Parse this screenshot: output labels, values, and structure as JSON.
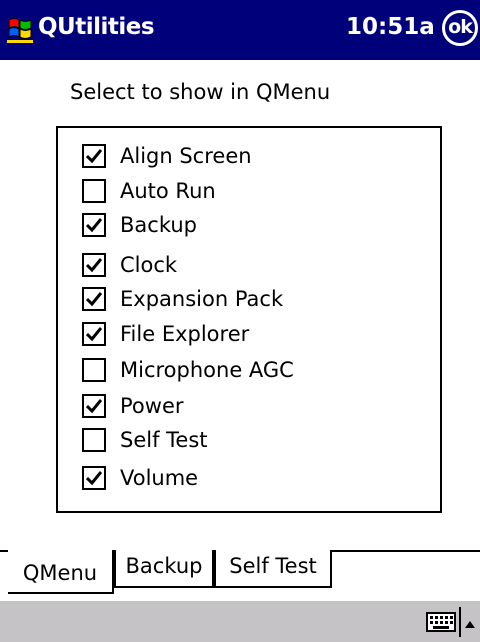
{
  "titlebar": {
    "app_title": "QUtilities",
    "time": "10:51a",
    "ok_label": "ok",
    "logo_icon": "windows-flag-icon",
    "bg_color": "#00007b"
  },
  "main": {
    "instruction": "Select to show in QMenu",
    "items": [
      {
        "label": "Align Screen",
        "checked": true
      },
      {
        "label": "Auto Run",
        "checked": false
      },
      {
        "label": "Backup",
        "checked": true
      },
      {
        "label": "Clock",
        "checked": true
      },
      {
        "label": "Expansion Pack",
        "checked": true
      },
      {
        "label": "File Explorer",
        "checked": true
      },
      {
        "label": "Microphone AGC",
        "checked": false
      },
      {
        "label": "Power",
        "checked": true
      },
      {
        "label": "Self Test",
        "checked": false
      },
      {
        "label": "Volume",
        "checked": true
      }
    ]
  },
  "tabs": [
    {
      "label": "QMenu",
      "active": true
    },
    {
      "label": "Backup",
      "active": false
    },
    {
      "label": "Self Test",
      "active": false
    }
  ],
  "bottombar": {
    "keyboard_icon": "keyboard-icon",
    "sip_arrow_icon": "up-arrow-icon",
    "bg_color": "#c6c3c6"
  }
}
